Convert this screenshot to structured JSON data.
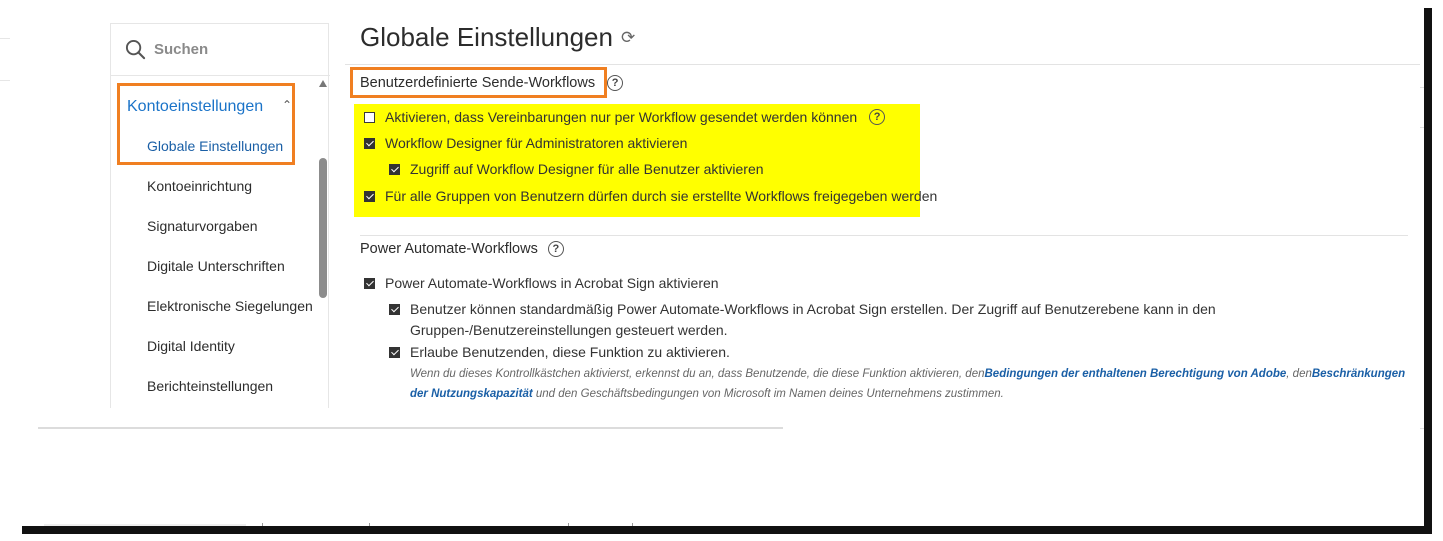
{
  "search": {
    "placeholder": "Suchen"
  },
  "sidebar": {
    "section_label": "Kontoeinstellungen",
    "items": [
      {
        "label": "Globale Einstellungen"
      },
      {
        "label": "Kontoeinrichtung"
      },
      {
        "label": "Signaturvorgaben"
      },
      {
        "label": "Digitale Unterschriften"
      },
      {
        "label": "Elektronische Siegelungen"
      },
      {
        "label": "Digital Identity"
      },
      {
        "label": "Berichteinstellungen"
      }
    ]
  },
  "main": {
    "title": "Globale Einstellungen",
    "custom_workflows": {
      "heading": "Benutzerdefinierte Sende-Workflows",
      "options": [
        {
          "label": "Aktivieren, dass Vereinbarungen nur per Workflow gesendet werden können",
          "checked": false
        },
        {
          "label": "Workflow Designer für Administratoren aktivieren",
          "checked": true
        },
        {
          "label": "Zugriff auf Workflow Designer für alle Benutzer aktivieren",
          "checked": true
        },
        {
          "label": "Für alle Gruppen von Benutzern dürfen durch sie erstellte Workflows freigegeben werden",
          "checked": true
        }
      ]
    },
    "power_automate": {
      "heading": "Power Automate-Workflows",
      "options": [
        {
          "label": "Power Automate-Workflows in Acrobat Sign aktivieren",
          "checked": true
        },
        {
          "label": "Benutzer können standardmäßig Power Automate-Workflows in Acrobat Sign erstellen. Der Zugriff auf Benutzerebene kann in den Gruppen-/Benutzereinstellungen gesteuert werden.",
          "checked": true
        },
        {
          "label": "Erlaube Benutzenden, diese Funktion zu aktivieren.",
          "checked": true
        }
      ],
      "note": {
        "part1": "Wenn du dieses Kontrollkästchen aktivierst, erkennst du an, dass Benutzende, die diese Funktion aktivieren, den",
        "link1": "Bedingungen der enthaltenen Berechtigung von Adobe",
        "part2": ", den",
        "link2": "Beschränkungen der Nutzungskapazität",
        "part3": " und den Geschäftsbedingungen von Microsoft im Namen deines Unternehmens zustimmen."
      }
    }
  },
  "icons": {
    "search": "search-icon",
    "refresh": "refresh-icon",
    "help": "help-icon",
    "collapse": "chevron-up-icon"
  },
  "colors": {
    "accent": "#1a73c8",
    "highlight_orange": "#f07f21",
    "highlight_yellow": "#ffff00"
  }
}
